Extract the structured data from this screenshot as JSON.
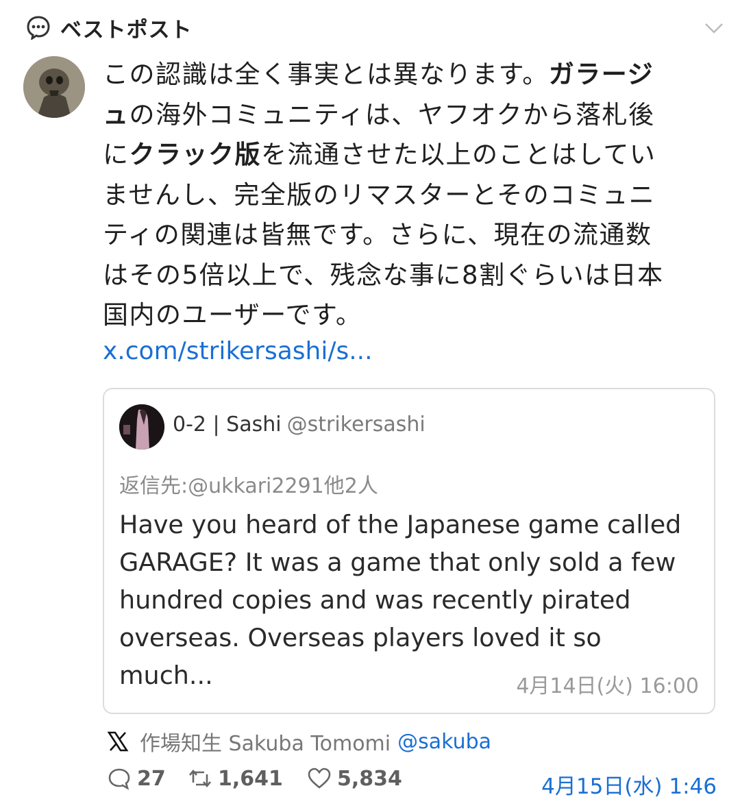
{
  "header": {
    "title": "ベストポスト"
  },
  "post": {
    "segments": [
      {
        "text": "この認識は全く事実とは異なります。",
        "bold": false
      },
      {
        "text": "ガラージュ",
        "bold": true
      },
      {
        "text": "の海外コミュニティは、ヤフオクから落札後に",
        "bold": false
      },
      {
        "text": "クラック版",
        "bold": true
      },
      {
        "text": "を流通させた以上のことはしていませんし、完全版のリマスターとそのコミュニティの関連は皆無です。さらに、現在の流通数はその5倍以上で、残念な事に8割ぐらいは日本国内のユーザーです。",
        "bold": false
      }
    ],
    "link": "x.com/strikersashi/s..."
  },
  "quote": {
    "name": "0-2 | Sashi",
    "handle": "@strikersashi",
    "reply_to": "返信先:@ukkari2291他2人",
    "body": "Have you heard of the Japanese game called GARAGE? It was a game that only sold a few hundred copies and was recently pirated overseas. Overseas players loved it so much...",
    "date": "4月14日(火) 16:00"
  },
  "source": {
    "name": "作場知生 Sakuba Tomomi",
    "handle": "@sakuba"
  },
  "stats": {
    "replies": "27",
    "reposts": "1,641",
    "likes": "5,834",
    "date": "4月15日(水) 1:46"
  },
  "colors": {
    "link": "#1a6fd4",
    "text": "#1f1f1f",
    "muted": "#8a8a8a"
  },
  "icons": [
    "speech-bubble-icon",
    "chevron-down-icon",
    "x-logo-icon",
    "reply-icon",
    "repost-icon",
    "like-icon"
  ]
}
